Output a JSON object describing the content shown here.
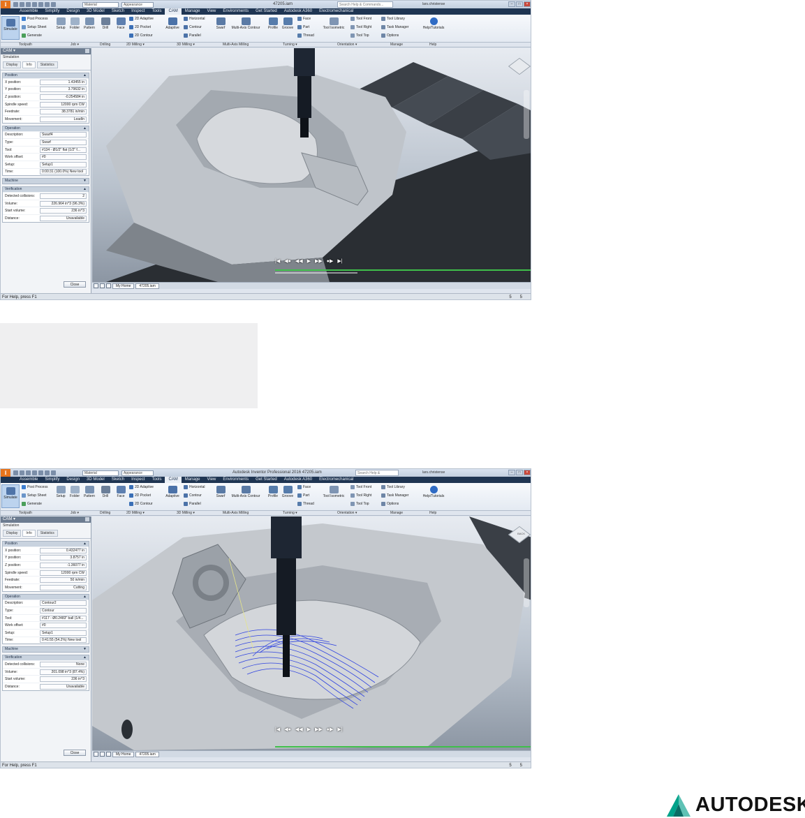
{
  "colors": {
    "brand": "#e8741c",
    "ribbon_dark": "#1f3552",
    "toolpath": "#2f43e0",
    "autodesk_green": "#00a28a"
  },
  "screens": [
    {
      "titlebar": {
        "material": "Material",
        "appearance": "Appearance",
        "title": "47205.iam",
        "search": "Search Help & Commands...",
        "user": "lars.christense"
      },
      "menu_tabs": [
        "Assemble",
        "Simplify",
        "Design",
        "3D Model",
        "Sketch",
        "Inspect",
        "Tools",
        "CAM",
        "Manage",
        "View",
        "Environments",
        "Get Started",
        "Autodesk A360",
        "Electromechanical"
      ],
      "ribbon": {
        "simulate": "Simulate",
        "post_process": "Post Process",
        "setup_sheet": "Setup Sheet",
        "generate": "Generate",
        "setup": "Setup",
        "folder": "Folder",
        "pattern": "Pattern",
        "drill": "Drill",
        "face": "Face",
        "adaptive_2d": "2D Adaptive",
        "pocket_2d": "2D Pocket",
        "contour_2d": "2D Contour",
        "adaptive": "Adaptive",
        "horizontal": "Horizontal",
        "contour": "Contour",
        "parallel": "Parallel",
        "swarf": "Swarf",
        "multi_axis_contour": "Multi-Axis Contour",
        "profile": "Profile",
        "groove": "Groove",
        "turn_face": "Face",
        "part": "Part",
        "thread": "Thread",
        "tool_isometric": "Tool Isometric",
        "tool_front": "Tool Front",
        "tool_right": "Tool Right",
        "tool_top": "Tool Top",
        "tool_library": "Tool Library",
        "task_manager": "Task Manager",
        "options": "Options",
        "help": "Help/Tutorials",
        "groups": [
          "Toolpath",
          "Job ▾",
          "Drilling",
          "2D Milling ▾",
          "3D Milling ▾",
          "Multi-Axis Milling",
          "Turning ▾",
          "Orientation ▾",
          "Manage",
          "Help"
        ]
      },
      "panel": {
        "header": "CAM ▾",
        "subtitle": "Simulation",
        "tabs": [
          "Display",
          "Info",
          "Statistics"
        ],
        "position": {
          "title": "Position",
          "labels": [
            "X position:",
            "Y position:",
            "Z position:",
            "Spindle speed:",
            "Feedrate:",
            "Movement:"
          ],
          "values": [
            "1.43455 in",
            "3.79632 in",
            "-0.254584 in",
            "12000 rpm CW",
            "38.3781 in/min",
            "LeadIn"
          ]
        },
        "operation": {
          "title": "Operation",
          "labels": [
            "Description:",
            "Type:",
            "Tool:",
            "Work offset:",
            "Setup:",
            "Time:"
          ],
          "values": [
            "Swarf4",
            "Swarf",
            "#134 - Ø1/2\" flat (1/2\" f...",
            "#0",
            "Setup1",
            "0:00:31 (100.0%) New tool"
          ]
        },
        "machine": {
          "title": "Machine"
        },
        "verification": {
          "title": "Verification",
          "labels": [
            "Detected collisions:",
            "Volume:",
            "Start volume:",
            "Distance:"
          ],
          "values": [
            "2",
            "226.964 in^3 (96.3%)",
            "236 in^3",
            "Unavailable"
          ]
        },
        "close": "Close"
      },
      "doc_tabs": [
        "My Home",
        "47205.iam"
      ],
      "status": {
        "left": "For Help, press F1",
        "n1": "5",
        "n2": "5"
      }
    },
    {
      "titlebar": {
        "material": "Material",
        "appearance": "Appearance",
        "title": "Autodesk Inventor Professional 2016    47205.iam",
        "search": "Search Help & Commands...",
        "user": "lars.christense"
      },
      "menu_tabs": [
        "Assemble",
        "Simplify",
        "Design",
        "3D Model",
        "Sketch",
        "Inspect",
        "Tools",
        "CAM",
        "Manage",
        "View",
        "Environments",
        "Get Started",
        "Autodesk A360",
        "Electromechanical"
      ],
      "panel": {
        "header": "CAM ▾",
        "subtitle": "Simulation",
        "tabs": [
          "Display",
          "Info",
          "Statistics"
        ],
        "position": {
          "title": "Position",
          "labels": [
            "X position:",
            "Y position:",
            "Z position:",
            "Spindle speed:",
            "Feedrate:",
            "Movement:"
          ],
          "values": [
            "0.432477 in",
            "3.8757 in",
            "-1.36077 in",
            "12000 rpm CW",
            "50 in/min",
            "Cutting"
          ]
        },
        "operation": {
          "title": "Operation",
          "labels": [
            "Description:",
            "Type:",
            "Tool:",
            "Work offset:",
            "Setup:",
            "Time:"
          ],
          "values": [
            "Contour2",
            "Contour",
            "#117 - Ø0.2483\" ball (1/4...",
            "#0",
            "Setup1",
            "0:41:55 (54.2%) New tool"
          ]
        },
        "machine": {
          "title": "Machine"
        },
        "verification": {
          "title": "Verification",
          "labels": [
            "Detected collisions:",
            "Volume:",
            "Start volume:",
            "Distance:"
          ],
          "values": [
            "None",
            "201.098 in^3 (87.4%)",
            "236 in^3",
            "Unavailable"
          ]
        },
        "close": "Close"
      },
      "viewcube_label": "BACK",
      "doc_tabs": [
        "My Home",
        "47205.iam"
      ],
      "status": {
        "left": "For Help, press F1",
        "n1": "5",
        "n2": "5"
      }
    }
  ],
  "autodesk": {
    "wordmark": "AUTODESK",
    "reg": "®"
  }
}
